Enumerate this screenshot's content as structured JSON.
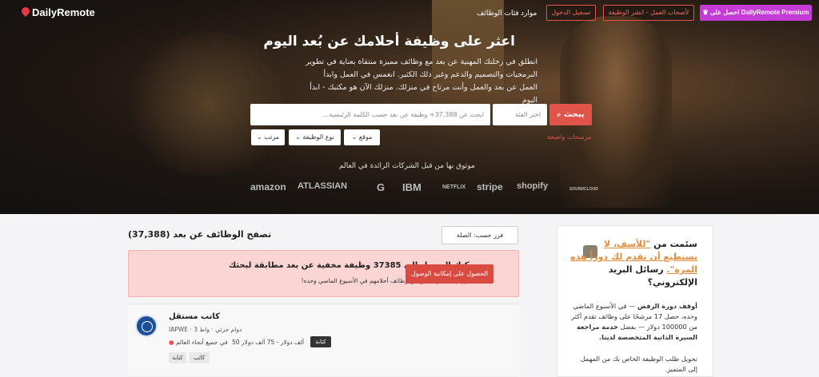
{
  "header": {
    "logo_text": "DailyRemote",
    "nav": [
      "موارد",
      "فئات الوظائف"
    ],
    "login_label": "تسجيل الدخول",
    "employers_label": "لأصحاب العمل - انشر الوظيفة",
    "premium_label": "احصل على DailyRemote Premium"
  },
  "hero": {
    "title": "اعثر على وظيفة أحلامك عن بُعد اليوم",
    "subtitle": "انطلق في رحلتك المهنية عن بعد مع وظائف مميزة منتقاة بعناية في تطوير البرمجيات والتصميم والدعم وغير ذلك الكثير. انغمس في العمل وابدأ العمل عن بعد والعمل وأنت مرتاح في منزلك. منزلك الآن هو مكتبك - ابدأ اليوم",
    "search_placeholder": "ابحث عن 37,388+ وظيفة عن بعد حسب الكلمة الرئيسية...",
    "category_placeholder": "اختر الفئة",
    "search_button": "يبحث",
    "suggestions_link": "مرشحات واضحة",
    "filters": [
      "موقع",
      "نوع الوظيفة",
      "مرتب"
    ],
    "trusted_text": "موثوق بها من قبل الشركات الرائدة في العالم",
    "brands": [
      "amazon",
      "ATLASSIAN",
      "G",
      "IBM",
      "NETFLIX",
      "stripe",
      "shopify",
      "SOUNDCLOUD"
    ]
  },
  "listing": {
    "heading": "تصفح الوظائف عن بعد (37,388)",
    "sort_label": "فرز حسب: الصلة",
    "banner_title": "يمكنك الوصول إلى 37385 وظيفة مخفية عن بعد مطابقة لبحثك",
    "banner_sub": "انضم إلى 57 مرشحًا وجدوا وظائف أحلامهم في الأسبوع الماضي وحده!",
    "banner_button": "الحصول على إمكانية الوصول",
    "jobs": [
      {
        "title": "كاتب مستقل",
        "company": "IAPWE",
        "type": "دوام جزئي",
        "posted": "واط 3",
        "category": "كتابة",
        "salary": "ألف دولار - 75 ألف دولار 50",
        "location": "في جميع أنحاء العالم",
        "tags": [
          "كاتب",
          "كتابة"
        ]
      }
    ]
  },
  "sidebar": {
    "heading_pre": "سئمت من",
    "heading_link": "\"للأسف، لا نستطيع أن نقدم لك دوراً هذه المرة\".",
    "heading_post": "رسائل البريد الإلكتروني؟",
    "para_bold1": "أوقف دورة الرفض",
    "para1": " — في الأسبوع الماضي وحده، حصل 17 مرشحًا على وظائف تقدم أكثر من 100000 دولار — بفضل ",
    "para_bold2": "خدمة مراجعة السيرة الذاتية المتخصصة لدينا.",
    "para2": "تحويل طلب الوظيفة الخاص بك من المهمل إلى المتميز."
  },
  "colors": {
    "accent": "#e0544a",
    "premium": "#c43bd6",
    "warning_bg": "#fbd4d4",
    "link_orange": "#e08d3c"
  }
}
